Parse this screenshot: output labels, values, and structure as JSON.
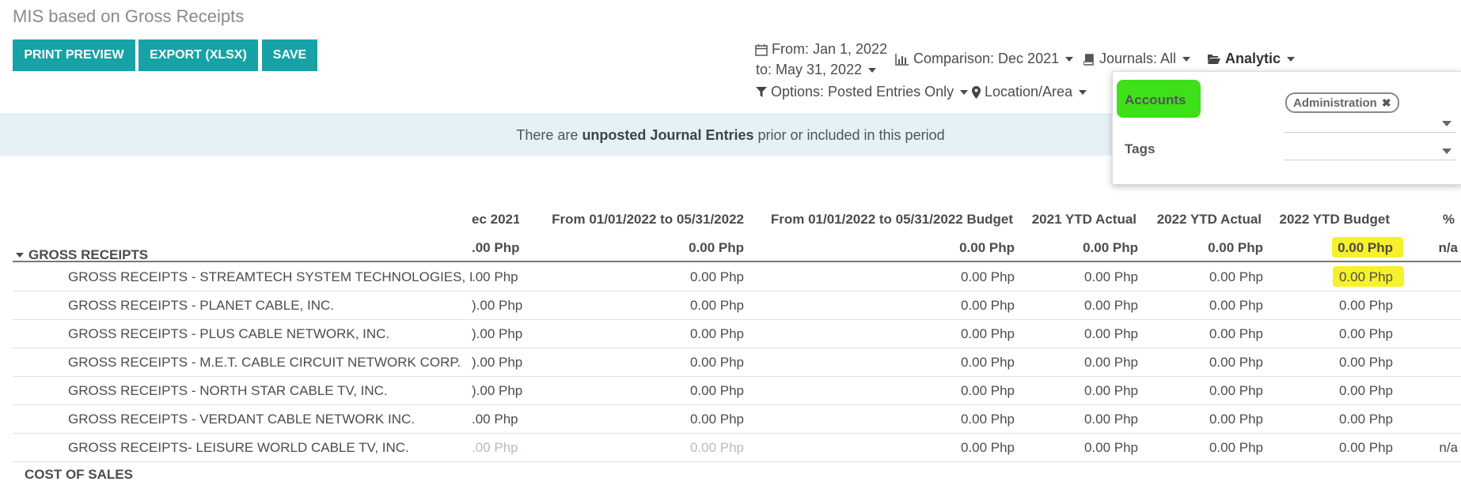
{
  "page_title": "MIS based on Gross Receipts",
  "buttons": {
    "print_preview": "PRINT PREVIEW",
    "export": "EXPORT (XLSX)",
    "save": "SAVE"
  },
  "filters": {
    "date_from": "From: Jan 1, 2022",
    "date_to": "to: May 31, 2022",
    "comparison": "Comparison: Dec 2021",
    "journals": "Journals: All",
    "analytic": "Analytic",
    "options": "Options: Posted Entries Only",
    "location": "Location/Area"
  },
  "banner": {
    "prefix": "There are ",
    "bold": "unposted Journal Entries",
    "suffix": " prior or included in this period"
  },
  "analytic_panel": {
    "accounts_label": "Accounts",
    "accounts_tag": "Administration",
    "tags_label": "Tags"
  },
  "table": {
    "headers": {
      "comparison": "ec 2021",
      "period": "From 01/01/2022 to 05/31/2022",
      "budget": "From 01/01/2022 to 05/31/2022 Budget",
      "ytd_2021": "2021 YTD Actual",
      "ytd_2022": "2022 YTD Actual",
      "ytd_budget": "2022 YTD Budget",
      "pct": "%"
    },
    "group_label": "GROSS RECEIPTS",
    "group_values": {
      "comparison": ".00 Php",
      "period": "0.00 Php",
      "budget": "0.00 Php",
      "ytd_2021": "0.00 Php",
      "ytd_2022": "0.00 Php",
      "ytd_budget": "0.00 Php",
      "pct": "n/a"
    },
    "rows": [
      {
        "label": "GROSS RECEIPTS - STREAMTECH SYSTEM TECHNOLOGIES, INC.",
        "comparison": ".00 Php",
        "period": "0.00 Php",
        "budget": "0.00 Php",
        "ytd_2021": "0.00 Php",
        "ytd_2022": "0.00 Php",
        "ytd_budget": "0.00 Php",
        "pct": ""
      },
      {
        "label": "GROSS RECEIPTS - PLANET CABLE, INC.",
        "comparison": ").00 Php",
        "period": "0.00 Php",
        "budget": "0.00 Php",
        "ytd_2021": "0.00 Php",
        "ytd_2022": "0.00 Php",
        "ytd_budget": "0.00 Php",
        "pct": ""
      },
      {
        "label": "GROSS RECEIPTS - PLUS CABLE NETWORK, INC.",
        "comparison": ").00 Php",
        "period": "0.00 Php",
        "budget": "0.00 Php",
        "ytd_2021": "0.00 Php",
        "ytd_2022": "0.00 Php",
        "ytd_budget": "0.00 Php",
        "pct": ""
      },
      {
        "label": "GROSS RECEIPTS - M.E.T. CABLE CIRCUIT NETWORK CORP.",
        "comparison": ").00 Php",
        "period": "0.00 Php",
        "budget": "0.00 Php",
        "ytd_2021": "0.00 Php",
        "ytd_2022": "0.00 Php",
        "ytd_budget": "0.00 Php",
        "pct": ""
      },
      {
        "label": "GROSS RECEIPTS - NORTH STAR CABLE TV, INC.",
        "comparison": ").00 Php",
        "period": "0.00 Php",
        "budget": "0.00 Php",
        "ytd_2021": "0.00 Php",
        "ytd_2022": "0.00 Php",
        "ytd_budget": "0.00 Php",
        "pct": ""
      },
      {
        "label": "GROSS RECEIPTS - VERDANT CABLE NETWORK INC.",
        "comparison": ".00 Php",
        "period": "0.00 Php",
        "budget": "0.00 Php",
        "ytd_2021": "0.00 Php",
        "ytd_2022": "0.00 Php",
        "ytd_budget": "0.00 Php",
        "pct": ""
      },
      {
        "label": "GROSS RECEIPTS- LEISURE WORLD CABLE TV, INC.",
        "comparison": ".00 Php",
        "period": "0.00 Php",
        "budget": "0.00 Php",
        "ytd_2021": "0.00 Php",
        "ytd_2022": "0.00 Php",
        "ytd_budget": "0.00 Php",
        "pct": "n/a"
      }
    ],
    "next_group_label": "COST OF SALES"
  },
  "colors": {
    "button": "#17a2a6",
    "banner_bg": "#e6f1f5",
    "highlight_green": "#3ee01a",
    "highlight_yellow": "#f6f12a"
  }
}
